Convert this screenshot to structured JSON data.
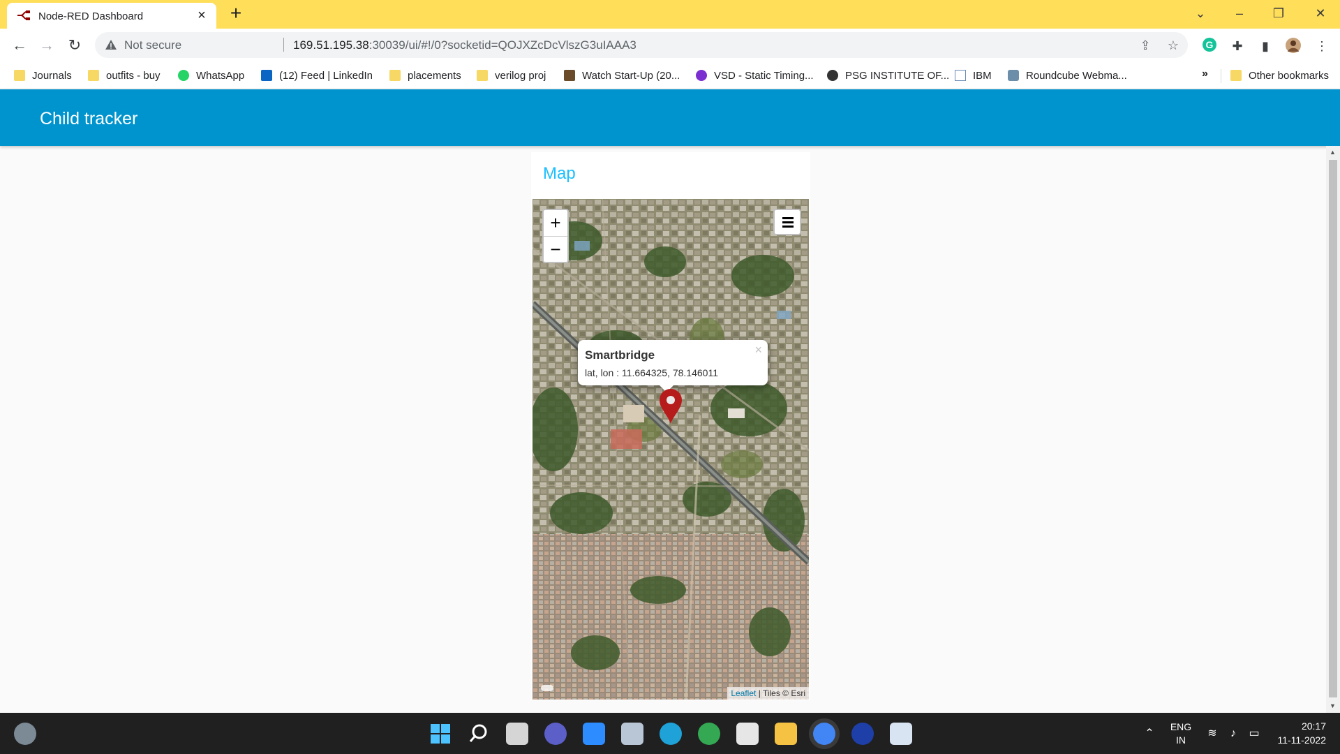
{
  "browser": {
    "tab_title": "Node-RED Dashboard",
    "tab_close": "×",
    "new_tab": "+",
    "security_label": "Not secure",
    "url_host": "169.51.195.38",
    "url_rest": ":30039/ui/#!/0?socketid=QOJXZcDcVlszG3uIAAA3",
    "accent_color": "#ffde5a"
  },
  "bookmarks": [
    {
      "label": "Journals",
      "icon": "folder-icon"
    },
    {
      "label": "outfits - buy",
      "icon": "folder-icon"
    },
    {
      "label": "WhatsApp",
      "icon": "whatsapp-icon"
    },
    {
      "label": "(12) Feed | LinkedIn",
      "icon": "linkedin-icon"
    },
    {
      "label": "placements",
      "icon": "folder-icon"
    },
    {
      "label": "verilog proj",
      "icon": "folder-icon"
    },
    {
      "label": "Watch Start-Up (20...",
      "icon": "tv-icon"
    },
    {
      "label": "VSD - Static Timing...",
      "icon": "vsd-icon"
    },
    {
      "label": "PSG INSTITUTE OF...",
      "icon": "globe-icon"
    },
    {
      "label": "IBM",
      "icon": "ibm-icon"
    },
    {
      "label": "Roundcube Webma...",
      "icon": "roundcube-icon"
    }
  ],
  "bookmarks_more": "»",
  "other_bookmarks": "Other bookmarks",
  "app": {
    "title": "Child tracker",
    "header_color": "#0094ce"
  },
  "card": {
    "title": "Map"
  },
  "map": {
    "zoom_in": "+",
    "zoom_out": "−",
    "popup_title": "Smartbridge",
    "popup_text": "lat, lon : 11.664325, 78.146011",
    "popup_close": "×",
    "attribution_link": "Leaflet",
    "attribution_rest": " | Tiles © Esri",
    "marker_color": "#b71c1c"
  },
  "taskbar": {
    "lang_top": "ENG",
    "lang_bottom": "IN",
    "time": "20:17",
    "date": "11-11-2022"
  }
}
